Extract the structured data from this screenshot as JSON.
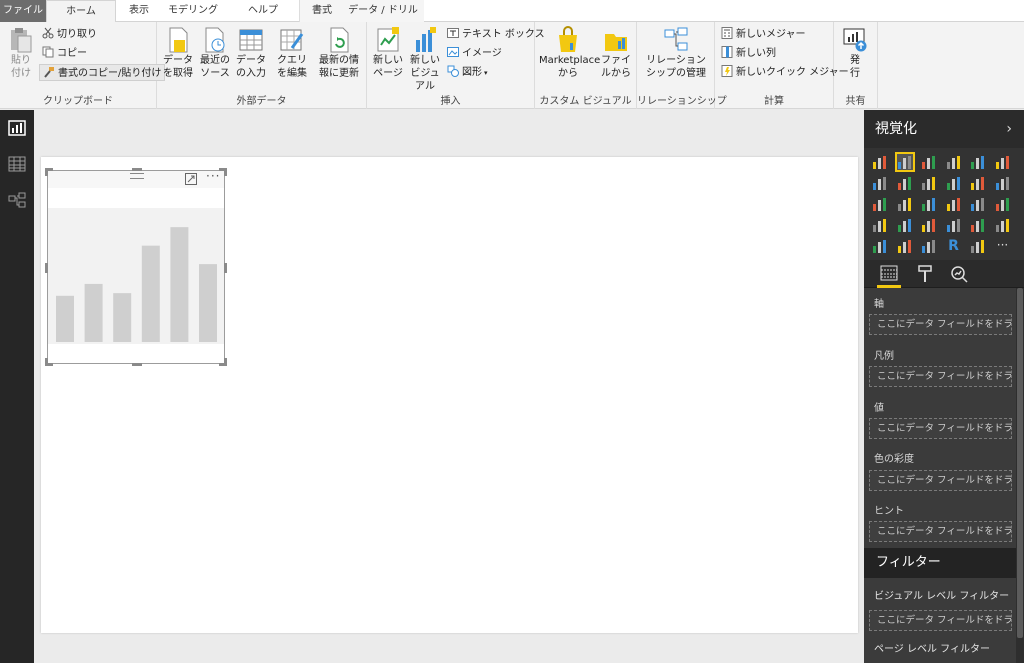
{
  "tabs": {
    "file": "ファイル",
    "home": "ホーム",
    "view": "表示",
    "modeling": "モデリング",
    "help": "ヘルプ",
    "format": "書式",
    "data_drill": "データ / ドリル"
  },
  "ribbon": {
    "clipboard": {
      "label": "クリップボード",
      "paste": "貼り付け",
      "cut": "切り取り",
      "copy": "コピー",
      "format_painter": "書式のコピー/貼り付け"
    },
    "external_data": {
      "label": "外部データ",
      "get_data": "データを取得",
      "recent_sources": "最近のソース",
      "enter_data": "データの入力",
      "edit_queries": "クエリを編集",
      "refresh": "最新の情報に更新"
    },
    "insert": {
      "label": "挿入",
      "new_page": "新しいページ",
      "new_visual": "新しいビジュアル",
      "text_box": "テキスト ボックス",
      "image": "イメージ",
      "shapes": "図形"
    },
    "custom_visuals": {
      "label": "カスタム ビジュアル",
      "marketplace": "Marketplaceから",
      "from_file": "ファイルから"
    },
    "relationships": {
      "label": "リレーションシップ",
      "manage": "リレーションシップの管理"
    },
    "calculations": {
      "label": "計算",
      "new_measure": "新しいメジャー",
      "new_column": "新しい列",
      "new_quick_measure": "新しいクイック メジャー"
    },
    "share": {
      "label": "共有",
      "publish": "発行"
    }
  },
  "visualizations": {
    "title": "視覚化",
    "fields": {
      "axis": "軸",
      "legend": "凡例",
      "values": "値",
      "color_saturation": "色の彩度",
      "tooltips": "ヒント",
      "placeholder": "ここにデータ フィールドをドラッグ..."
    },
    "selected_visual": "clustered-column-chart"
  },
  "filters": {
    "title": "フィルター",
    "visual_level": "ビジュアル レベル フィルター",
    "page_level": "ページ レベル フィルター",
    "placeholder": "ここにデータ フィールドをドラッグ..."
  },
  "placeholder_chart": {
    "bar_values": [
      0.35,
      0.44,
      0.37,
      0.73,
      0.87,
      0.59
    ]
  },
  "colors": {
    "accent": "#f2c811",
    "ribbon_bg": "#f3f3f3",
    "pane_dark": "#333333",
    "bar_gray": "#cfcfcf"
  }
}
